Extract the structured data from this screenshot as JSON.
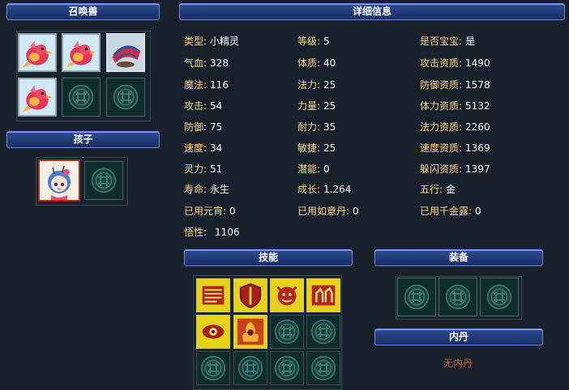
{
  "headers": {
    "summon": "召唤兽",
    "details": "详细信息",
    "child": "孩子",
    "skills": "技能",
    "equipment": "装备",
    "neidan": "内丹"
  },
  "pet_slots": [
    {
      "icon": "red-bird-pet-icon",
      "filled": true
    },
    {
      "icon": "red-bird-pet-icon",
      "filled": true
    },
    {
      "icon": "red-fan-pet-icon",
      "filled": true,
      "selected": true
    },
    {
      "icon": "red-bird-pet-icon",
      "filled": true
    },
    {
      "icon": "empty-slot-emblem-icon",
      "filled": false
    },
    {
      "icon": "empty-slot-emblem-icon",
      "filled": false
    }
  ],
  "child_slots": [
    {
      "icon": "elf-child-portrait-icon",
      "filled": true
    },
    {
      "icon": "empty-slot-emblem-icon",
      "filled": false
    }
  ],
  "attributes": {
    "col1": [
      {
        "label": "类型:",
        "value": "小精灵"
      },
      {
        "label": "气血:",
        "value": "328"
      },
      {
        "label": "魔法:",
        "value": "116"
      },
      {
        "label": "攻击:",
        "value": "54"
      },
      {
        "label": "防御:",
        "value": "75"
      },
      {
        "label": "速度:",
        "value": "34"
      },
      {
        "label": "灵力:",
        "value": "51"
      },
      {
        "label": "寿命:",
        "value": "永生"
      },
      {
        "label": "已用元宵:",
        "value": "0"
      },
      {
        "label": "悟性:",
        "value": "1106"
      }
    ],
    "col2": [
      {
        "label": "等级:",
        "value": "5"
      },
      {
        "label": "体质:",
        "value": "40"
      },
      {
        "label": "法力:",
        "value": "25"
      },
      {
        "label": "力量:",
        "value": "25"
      },
      {
        "label": "耐力:",
        "value": "35"
      },
      {
        "label": "敏捷:",
        "value": "25"
      },
      {
        "label": "潜能:",
        "value": "0"
      },
      {
        "label": "成长:",
        "value": "1.264"
      },
      {
        "label": "已用如意丹:",
        "value": "0"
      }
    ],
    "col3": [
      {
        "label": "是否宝宝:",
        "value": "是"
      },
      {
        "label": "攻击资质:",
        "value": "1490"
      },
      {
        "label": "防御资质:",
        "value": "1578"
      },
      {
        "label": "体力资质:",
        "value": "5132"
      },
      {
        "label": "法力资质:",
        "value": "2260"
      },
      {
        "label": "速度资质:",
        "value": "1369"
      },
      {
        "label": "躲闪资质:",
        "value": "1397"
      },
      {
        "label": "五行:",
        "value": "金"
      },
      {
        "label": "已用千金露:",
        "value": "0"
      }
    ]
  },
  "skills": [
    {
      "icon": "scroll-skill-icon",
      "active": true
    },
    {
      "icon": "shield-skill-icon",
      "active": true
    },
    {
      "icon": "demon-face-skill-icon",
      "active": true
    },
    {
      "icon": "fighters-skill-icon",
      "active": true
    },
    {
      "icon": "eye-skill-icon",
      "active": true
    },
    {
      "icon": "fire-figure-skill-icon",
      "active": true
    },
    {
      "icon": "empty-slot-emblem-icon",
      "active": false
    },
    {
      "icon": "empty-slot-emblem-icon",
      "active": false
    },
    {
      "icon": "empty-slot-emblem-icon",
      "active": false
    },
    {
      "icon": "empty-slot-emblem-icon",
      "active": false
    },
    {
      "icon": "empty-slot-emblem-icon",
      "active": false
    },
    {
      "icon": "empty-slot-emblem-icon",
      "active": false
    }
  ],
  "equipment_slots": [
    {
      "icon": "empty-slot-emblem-icon"
    },
    {
      "icon": "empty-slot-emblem-icon"
    },
    {
      "icon": "empty-slot-emblem-icon"
    }
  ],
  "neidan_text": "无内丹",
  "colors": {
    "background": "#17202b",
    "header_blue": "#213a78",
    "label_gold": "#ffd98a",
    "value_white": "#ffffff",
    "neidan_orange": "#d6602e",
    "skill_gold": "#e6d21c"
  }
}
